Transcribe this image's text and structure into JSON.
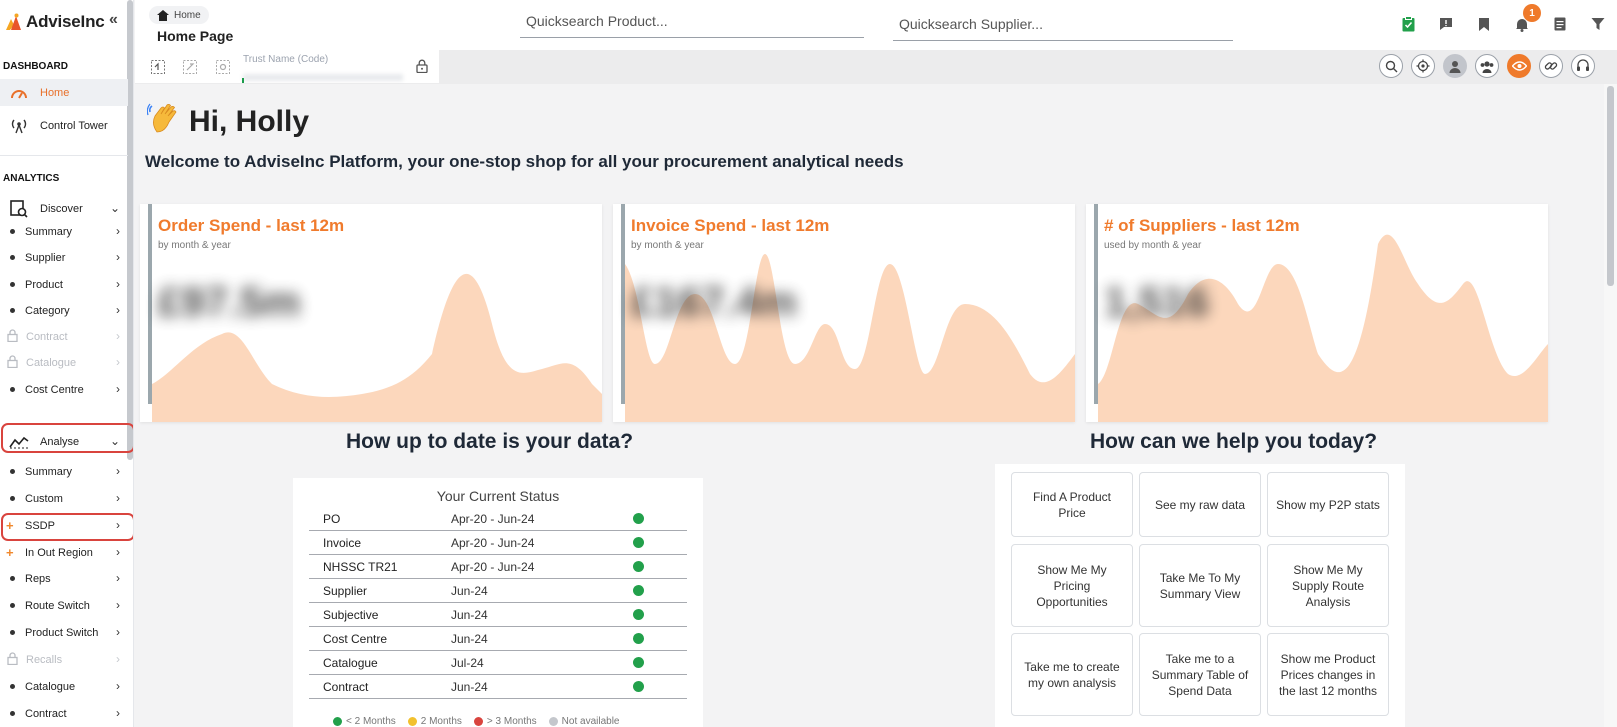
{
  "brand": {
    "name": "AdviseInc",
    "accent": "#f07b2d",
    "collapse_glyph": "«"
  },
  "sidebar": {
    "dashboard_heading": "DASHBOARD",
    "dashboard_items": [
      {
        "label": "Home",
        "icon": "speedometer-icon",
        "active": true
      },
      {
        "label": "Control Tower",
        "icon": "antenna-icon"
      }
    ],
    "analytics_heading": "ANALYTICS",
    "discover": {
      "label": "Discover",
      "children": [
        {
          "label": "Summary"
        },
        {
          "label": "Supplier"
        },
        {
          "label": "Product"
        },
        {
          "label": "Category"
        },
        {
          "label": "Contract",
          "locked": true
        },
        {
          "label": "Catalogue",
          "locked": true
        },
        {
          "label": "Cost Centre"
        }
      ]
    },
    "analyse": {
      "label": "Analyse",
      "children": [
        {
          "label": "Summary"
        },
        {
          "label": "Custom"
        },
        {
          "label": "SSDP",
          "new": true
        },
        {
          "label": "In Out Region",
          "new": true
        },
        {
          "label": "Reps"
        },
        {
          "label": "Route Switch"
        },
        {
          "label": "Product Switch"
        },
        {
          "label": "Recalls",
          "locked": true
        },
        {
          "label": "Catalogue"
        },
        {
          "label": "Contract"
        }
      ]
    }
  },
  "header": {
    "breadcrumb": "Home",
    "page_title": "Home Page",
    "quicksearch_product": "Quicksearch Product...",
    "quicksearch_supplier": "Quicksearch Supplier...",
    "notification_count": "1",
    "trust_label": "Trust Name (Code)",
    "toolbar_icons": [
      "clipboard-icon",
      "flag-icon",
      "bookmark-icon",
      "bell-icon",
      "notes-icon",
      "filter-icon"
    ],
    "view_icons": [
      "search-icon",
      "target-icon",
      "user-icon",
      "group-icon",
      "eye-icon",
      "link-icon",
      "headset-icon"
    ]
  },
  "main": {
    "greeting": "Hi, Holly",
    "welcome": "Welcome to AdviseInc Platform, your one-stop shop for all your procurement analytical needs",
    "cards": [
      {
        "title": "Order Spend - last 12m",
        "subtitle": "by month & year",
        "value": "£97.5m"
      },
      {
        "title": "Invoice Spend - last 12m",
        "subtitle": "by month & year",
        "value": "£167.4m"
      },
      {
        "title": "# of Suppliers - last 12m",
        "subtitle": "used by month & year",
        "value": "1,516"
      }
    ],
    "data_heading": "How up to date is your data?",
    "status": {
      "title": "Your Current Status",
      "rows": [
        {
          "name": "PO",
          "range": "Apr-20 - Jun-24"
        },
        {
          "name": "Invoice",
          "range": "Apr-20 - Jun-24"
        },
        {
          "name": "NHSSC TR21",
          "range": "Apr-20 - Jun-24"
        },
        {
          "name": "Supplier",
          "range": "Jun-24"
        },
        {
          "name": "Subjective",
          "range": "Jun-24"
        },
        {
          "name": "Cost Centre",
          "range": "Jun-24"
        },
        {
          "name": "Catalogue",
          "range": "Jul-24"
        },
        {
          "name": "Contract",
          "range": "Jun-24"
        }
      ],
      "ok_color": "#22a04b",
      "legend": [
        {
          "label": "< 2 Months",
          "color": "#22a04b"
        },
        {
          "label": "2 Months",
          "color": "#f2c12e"
        },
        {
          "label": "> 3 Months",
          "color": "#d9443e"
        },
        {
          "label": "Not available",
          "color": "#c4c7cc"
        }
      ]
    },
    "help_heading": "How can we help you today?",
    "help_buttons": [
      "Find A Product Price",
      "See my raw data",
      "Show my P2P stats",
      "Show Me My Pricing Opportunities",
      "Take Me To My Summary View",
      "Show Me My Supply Route Analysis",
      "Take me to create my own analysis",
      "Take me to a Summary Table of Spend Data",
      "Show me Product Prices changes in the last 12 months"
    ]
  }
}
